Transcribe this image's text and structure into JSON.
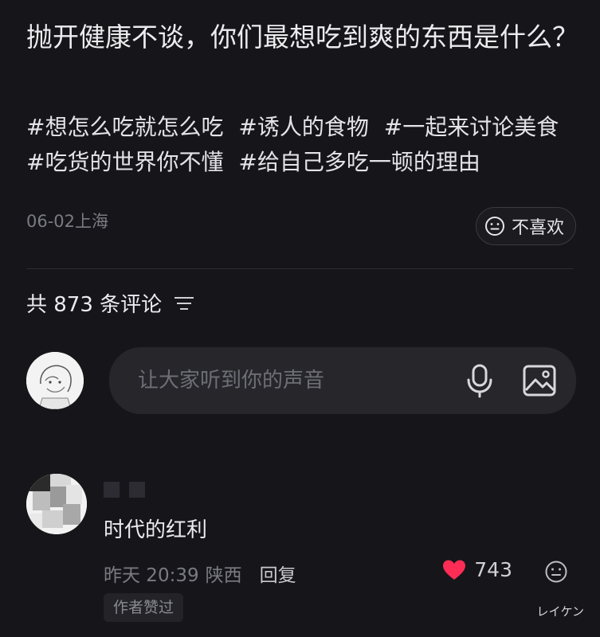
{
  "post": {
    "title": "抛开健康不谈，你们最想吃到爽的东西是什么？",
    "tags": [
      "#想怎么吃就怎么吃",
      "#诱人的食物",
      "#一起来讨论美食",
      "#吃货的世界你不懂",
      "#给自己多吃一顿的理由"
    ],
    "meta": "06-02上海",
    "dislike_label": "不喜欢"
  },
  "comments_header": {
    "label": "共 873 条评论"
  },
  "composer": {
    "placeholder": "让大家听到你的声音"
  },
  "comment": {
    "text": "时代的红利",
    "time": "昨天 20:39",
    "location": "陕西",
    "reply_label": "回复",
    "likes": "743",
    "badge": "作者赞过"
  },
  "watermark": "レイケン",
  "colors": {
    "background": "#16161a",
    "like": "#ff2d55",
    "muted": "#7a7a82"
  }
}
